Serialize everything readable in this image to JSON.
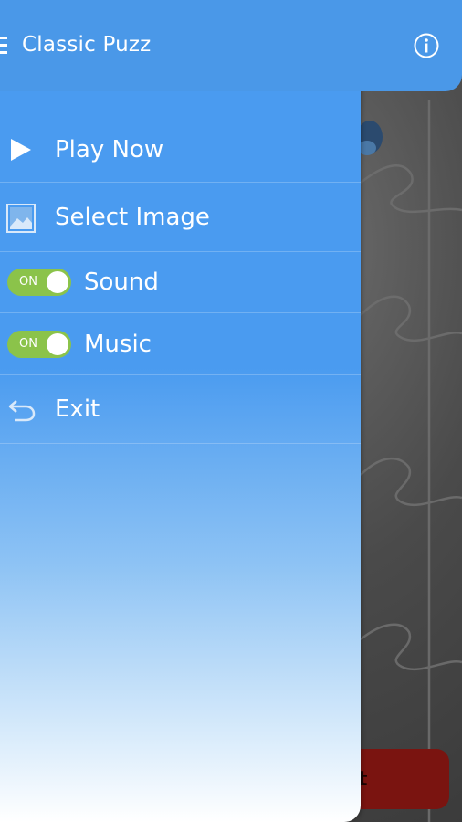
{
  "appbar": {
    "title": "Classic Puzz"
  },
  "menu": {
    "play_now": "Play Now",
    "select_image": "Select Image",
    "sound": {
      "label": "Sound",
      "state": "ON"
    },
    "music": {
      "label": "Music",
      "state": "ON"
    },
    "exit": "Exit"
  },
  "background": {
    "button_text": "t"
  },
  "colors": {
    "appbar": "#4a98e8",
    "toggle_on": "#8bc34a",
    "bottom_button": "#7a1410"
  }
}
